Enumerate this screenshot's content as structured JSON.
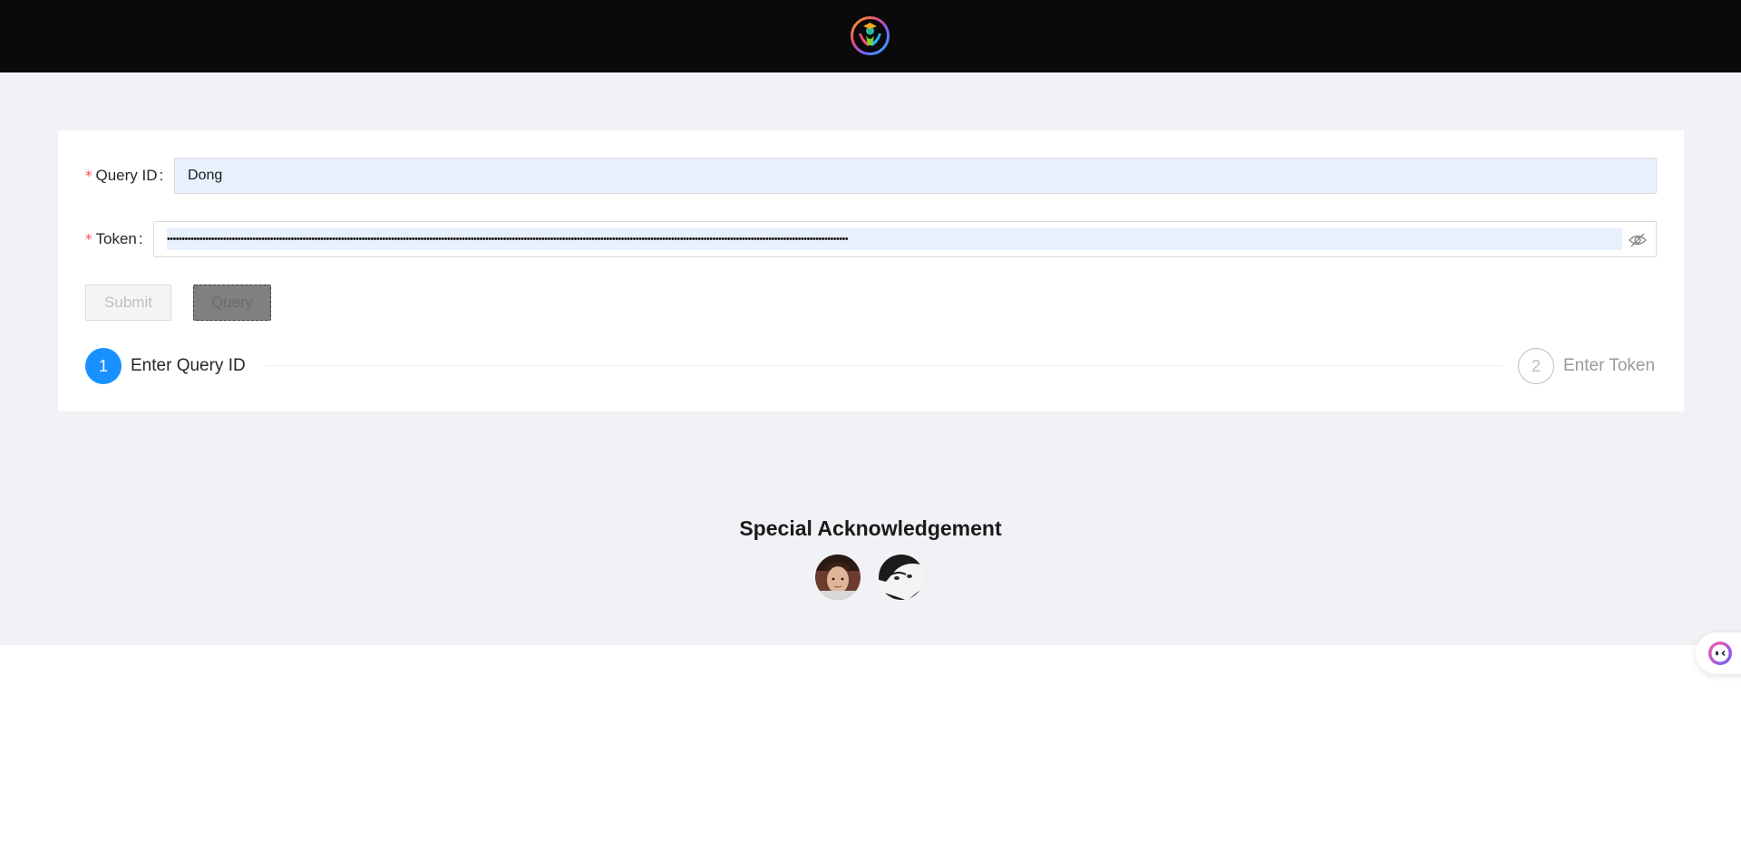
{
  "header": {
    "logo_icon": "multicolor-people-logo-icon"
  },
  "form": {
    "query_id": {
      "label": "Query ID",
      "required_mark": "*",
      "colon": ":",
      "value": "Dong"
    },
    "token": {
      "label": "Token",
      "required_mark": "*",
      "colon": ":",
      "value": "•••••••••••••••••••••••••••••••••••••••••••••••••••••••••••••••••••••••••••••••••••••••••••••••••••••••••••••••••••••••••••••••••••••••••••••••••••••••••••••••••••••••••••••••••••••••••••••••••••••••••••••••••••••••••••••••••••••••",
      "visibility_icon": "eye-off-icon"
    },
    "buttons": {
      "submit_label": "Submit",
      "query_label": "Query"
    }
  },
  "steps": [
    {
      "number": "1",
      "title": "Enter Query ID",
      "status": "active"
    },
    {
      "number": "2",
      "title": "Enter Token",
      "status": "waiting"
    }
  ],
  "acknowledgement": {
    "title": "Special Acknowledgement",
    "avatars": [
      "avatar-photo",
      "avatar-anime"
    ]
  },
  "floating": {
    "icon": "assistant-robot-icon"
  },
  "colors": {
    "header_bg": "#0a0a0b",
    "page_bg": "#f0f2f5",
    "primary": "#1890ff",
    "required": "#ff4d4f",
    "autofill_bg": "#e8f0fe"
  }
}
